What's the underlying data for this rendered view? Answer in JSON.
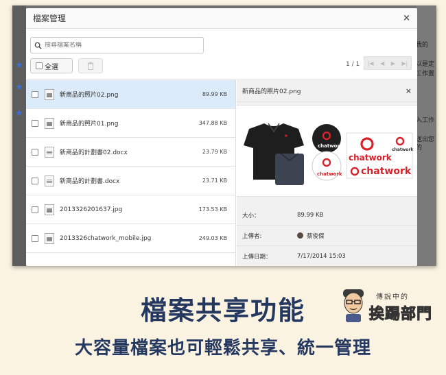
{
  "dialog": {
    "title": "檔案管理",
    "close": "×",
    "search_placeholder": "搜尋檔案名稱",
    "select_all": "全選",
    "pagination": "1 / 1"
  },
  "files": [
    {
      "name": "新商品的照片02.png",
      "size": "89.99 KB",
      "type": "image",
      "selected": true
    },
    {
      "name": "新商品的照片01.png",
      "size": "347.88 KB",
      "type": "image",
      "selected": false
    },
    {
      "name": "新商品的計劃書02.docx",
      "size": "23.79 KB",
      "type": "doc",
      "selected": false
    },
    {
      "name": "新商品的計劃書.docx",
      "size": "23.71 KB",
      "type": "doc",
      "selected": false
    },
    {
      "name": "2013326201637.jpg",
      "size": "173.53 KB",
      "type": "image",
      "selected": false
    },
    {
      "name": "2013326chatwork_mobile.jpg",
      "size": "249.03 KB",
      "type": "image",
      "selected": false
    }
  ],
  "detail": {
    "title": "新商品的照片02.png",
    "close": "×",
    "brand": "chatwork",
    "size_label": "大小：",
    "size_value": "89.99 KB",
    "uploader_label": "上傳者:",
    "uploader_value": "蔡俊傑",
    "date_label": "上傳日期：",
    "date_value": "7/17/2014 15:03"
  },
  "background": {
    "right_texts": [
      "我的",
      "以是定",
      "工作置",
      "入工作",
      "送出您的"
    ]
  },
  "caption": {
    "title": "檔案共享功能",
    "subtitle": "大容量檔案也可輕鬆共享、統一管理"
  },
  "logo": {
    "small": "傳說中的",
    "big": "挨踢部門"
  },
  "colors": {
    "caption": "#25385f",
    "selected_row": "#dcebf9",
    "brand_red": "#d8212b",
    "star": "#3a6fd8"
  }
}
